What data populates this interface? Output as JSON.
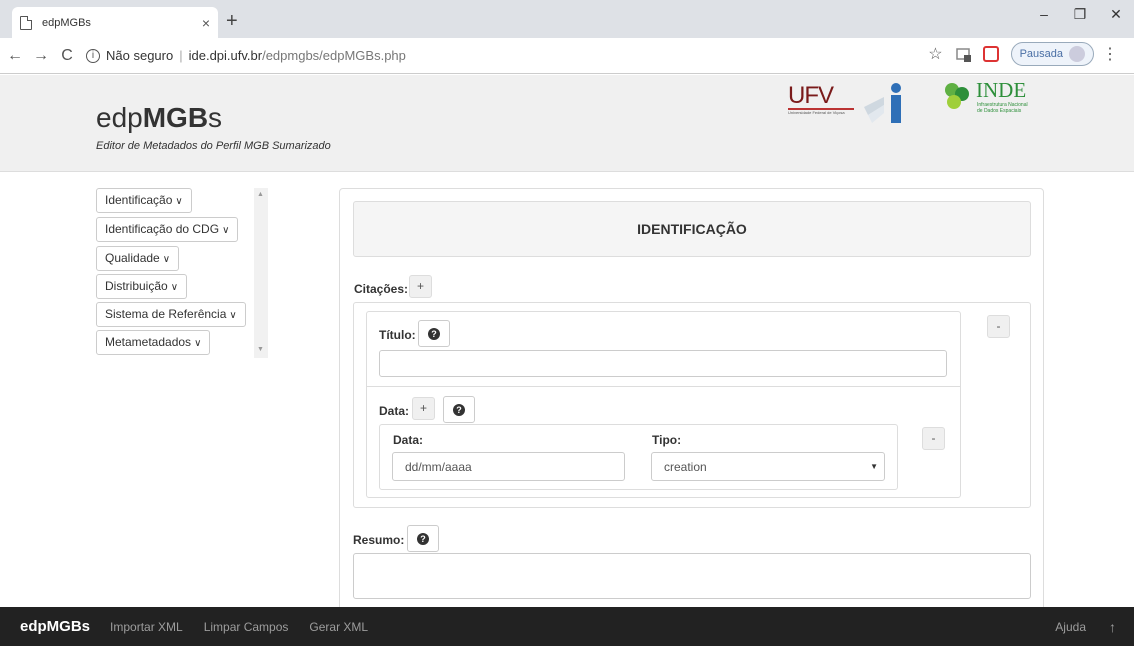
{
  "browser": {
    "tab_title": "edpMGBs",
    "tab_close": "×",
    "new_tab": "+",
    "win_min": "–",
    "win_max": "❐",
    "win_close": "✕",
    "back": "←",
    "forward": "→",
    "reload": "C",
    "info": "i",
    "not_secure": "Não seguro",
    "url_host": "ide.dpi.ufv.br",
    "url_path": "/edpmgbs/edpMGBs.php",
    "star": "☆",
    "paused": "Pausada",
    "menu": "⋮"
  },
  "header": {
    "brand_light": "edp",
    "brand_bold": "MGB",
    "brand_end": "s",
    "subtitle": "Editor de Metadados do Perfil MGB Sumarizado",
    "ufv_text": "UFV",
    "ufv_sub": "Universidade Federal de Viçosa",
    "inde_text": "INDE",
    "inde_sub1": "Infraestrutura Nacional",
    "inde_sub2": "de Dados Espaciais"
  },
  "sidebar": {
    "items": [
      {
        "label": "Identificação"
      },
      {
        "label": "Identificação do CDG"
      },
      {
        "label": "Qualidade"
      },
      {
        "label": "Distribuição"
      },
      {
        "label": "Sistema de Referência"
      },
      {
        "label": "Metametadados"
      }
    ],
    "chevron": "∨"
  },
  "main": {
    "section_title": "IDENTIFICAÇÃO",
    "citacoes_label": "Citações:",
    "titulo_label": "Título:",
    "data_group_label": "Data:",
    "data_label": "Data:",
    "data_placeholder": "dd/mm/aaaa",
    "tipo_label": "Tipo:",
    "tipo_value": "creation",
    "resumo_label": "Resumo:",
    "plus": "+",
    "minus": "-",
    "help": "?"
  },
  "footer": {
    "brand": "edpMGBs",
    "links": [
      "Importar XML",
      "Limpar Campos",
      "Gerar XML"
    ],
    "help": "Ajuda",
    "up": "↑"
  }
}
